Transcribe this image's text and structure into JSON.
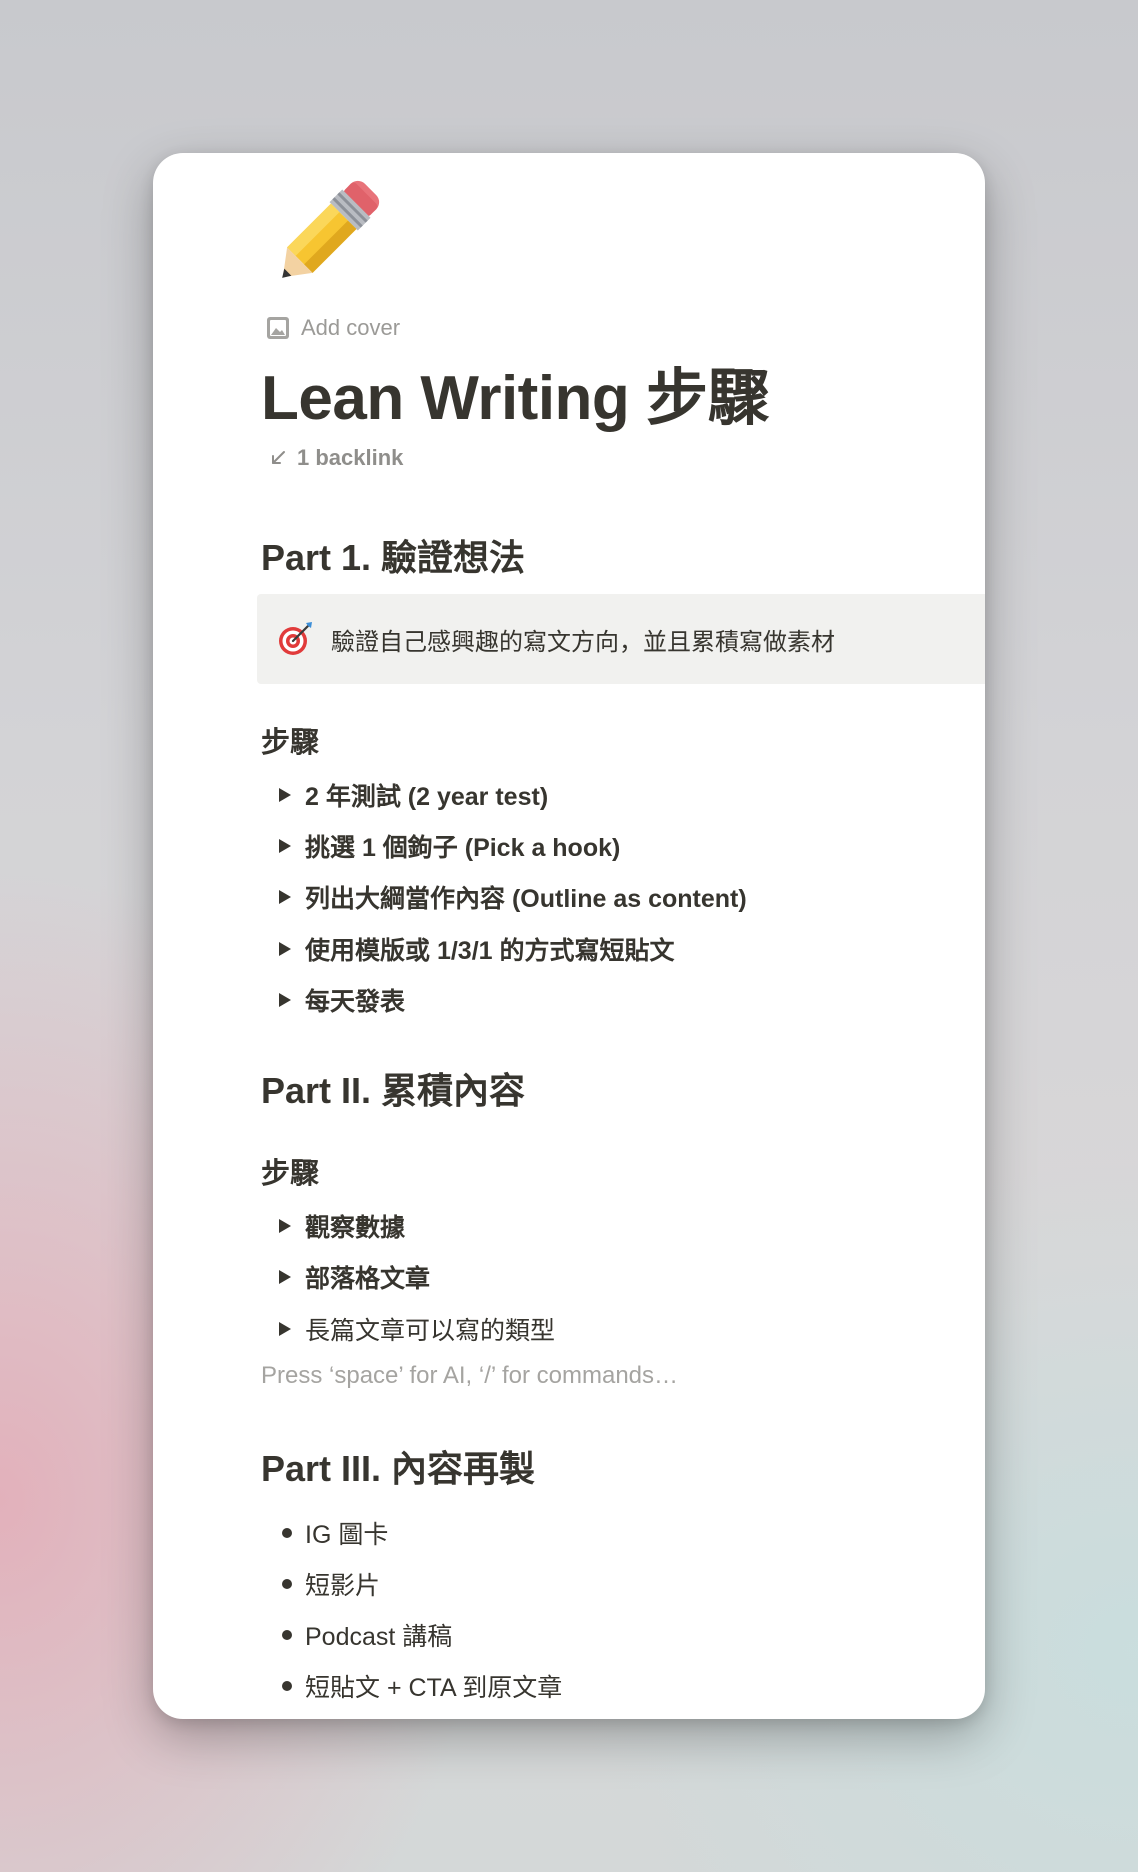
{
  "page": {
    "icon": "pencil-icon",
    "add_cover": "Add cover",
    "title": "Lean Writing 步驟",
    "backlink": "1 backlink"
  },
  "part1": {
    "heading": "Part 1. 驗證想法",
    "callout": {
      "icon": "dart-target-icon",
      "text": "驗證自己感興趣的寫文方向，並且累積寫做素材"
    },
    "steps_heading": "步驟",
    "steps": [
      "2 年測試 (2 year test)",
      "挑選 1 個鉤子 (Pick a hook)",
      "列出大綱當作內容 (Outline as content)",
      "使用模版或 1/3/1 的方式寫短貼文",
      "每天發表"
    ]
  },
  "part2": {
    "heading": "Part II. 累積內容",
    "steps_heading": "步驟",
    "steps": [
      "觀察數據",
      "部落格文章",
      "長篇文章可以寫的類型"
    ],
    "placeholder": "Press ‘space’ for AI, ‘/’ for commands…"
  },
  "part3": {
    "heading": "Part III. 內容再製",
    "bullets": [
      "IG 圖卡",
      "短影片",
      "Podcast 講稿",
      "短貼文 + CTA 到原文章"
    ]
  }
}
